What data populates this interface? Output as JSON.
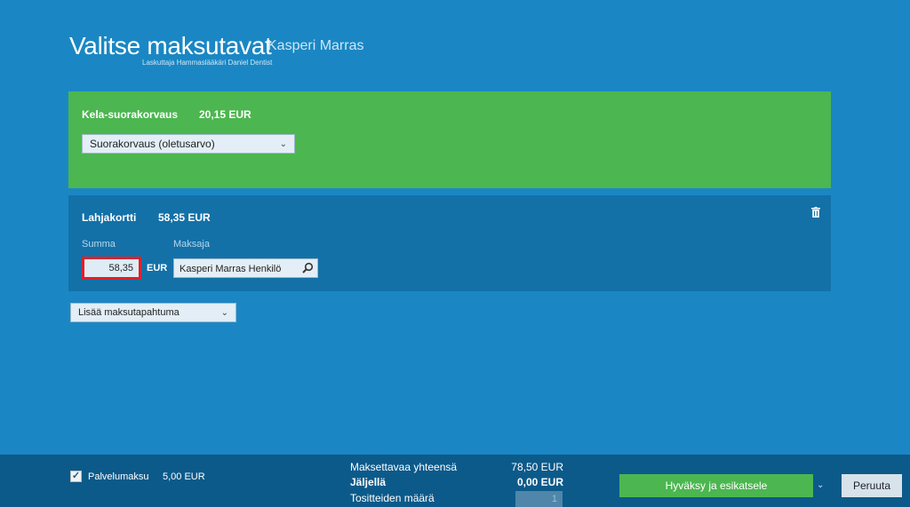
{
  "header": {
    "title": "Valitse maksutavat",
    "customer": "Kasperi Marras",
    "biller": "Laskuttaja Hammaslääkäri Daniel Dentist"
  },
  "kela": {
    "label": "Kela-suorakorvaus",
    "amount": "20,15 EUR",
    "select_value": "Suorakorvaus (oletusarvo)"
  },
  "gift": {
    "label": "Lahjakortti",
    "amount": "58,35 EUR",
    "sum_label": "Summa",
    "payer_label": "Maksaja",
    "sum_value": "58,35",
    "currency": "EUR",
    "payer_value": "Kasperi Marras Henkilö"
  },
  "add_payment": {
    "label": "Lisää maksutapahtuma"
  },
  "footer": {
    "service_fee_label": "Palvelumaksu",
    "service_fee_amount": "5,00 EUR",
    "service_fee_checked": true,
    "total_label": "Maksettavaa yhteensä",
    "total_value": "78,50 EUR",
    "remaining_label": "Jäljellä",
    "remaining_value": "0,00 EUR",
    "receipts_label": "Tositteiden määrä",
    "receipts_value": "1",
    "approve_label": "Hyväksy ja esikatsele",
    "cancel_label": "Peruuta"
  },
  "colors": {
    "background": "#1a87c4",
    "kela_panel": "#4cb650",
    "gift_panel": "#1371a8",
    "footer": "#0c5a8a",
    "highlight": "#e0202a"
  },
  "icons": [
    "chevron-down-icon",
    "trash-icon",
    "search-icon",
    "checkmark-icon"
  ]
}
